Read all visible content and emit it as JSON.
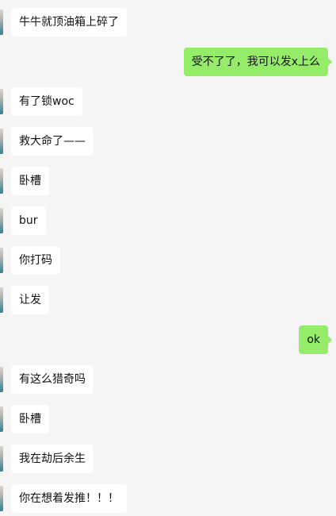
{
  "colors": {
    "background": "#f5f5f5",
    "incoming_bubble": "#ffffff",
    "outgoing_bubble": "#95ec69",
    "text": "#111111"
  },
  "messages": [
    {
      "side": "left",
      "text": "牛牛就顶油箱上碎了",
      "avatar_icon": "contact-avatar"
    },
    {
      "side": "right",
      "text": "受不了了，我可以发x上么"
    },
    {
      "side": "left",
      "text": "有了锁woc",
      "avatar_icon": "contact-avatar"
    },
    {
      "side": "left",
      "text": "救大命了——",
      "avatar_icon": "contact-avatar"
    },
    {
      "side": "left",
      "text": "卧槽",
      "avatar_icon": "contact-avatar"
    },
    {
      "side": "left",
      "text": "bur",
      "avatar_icon": "contact-avatar"
    },
    {
      "side": "left",
      "text": "你打码",
      "avatar_icon": "contact-avatar"
    },
    {
      "side": "left",
      "text": "让发",
      "avatar_icon": "contact-avatar"
    },
    {
      "side": "right",
      "text": "ok"
    },
    {
      "side": "left",
      "text": "有这么猎奇吗",
      "avatar_icon": "contact-avatar"
    },
    {
      "side": "left",
      "text": "卧槽",
      "avatar_icon": "contact-avatar"
    },
    {
      "side": "left",
      "text": "我在劫后余生",
      "avatar_icon": "contact-avatar"
    },
    {
      "side": "left",
      "text": "你在想着发推！！！",
      "avatar_icon": "contact-avatar"
    }
  ]
}
